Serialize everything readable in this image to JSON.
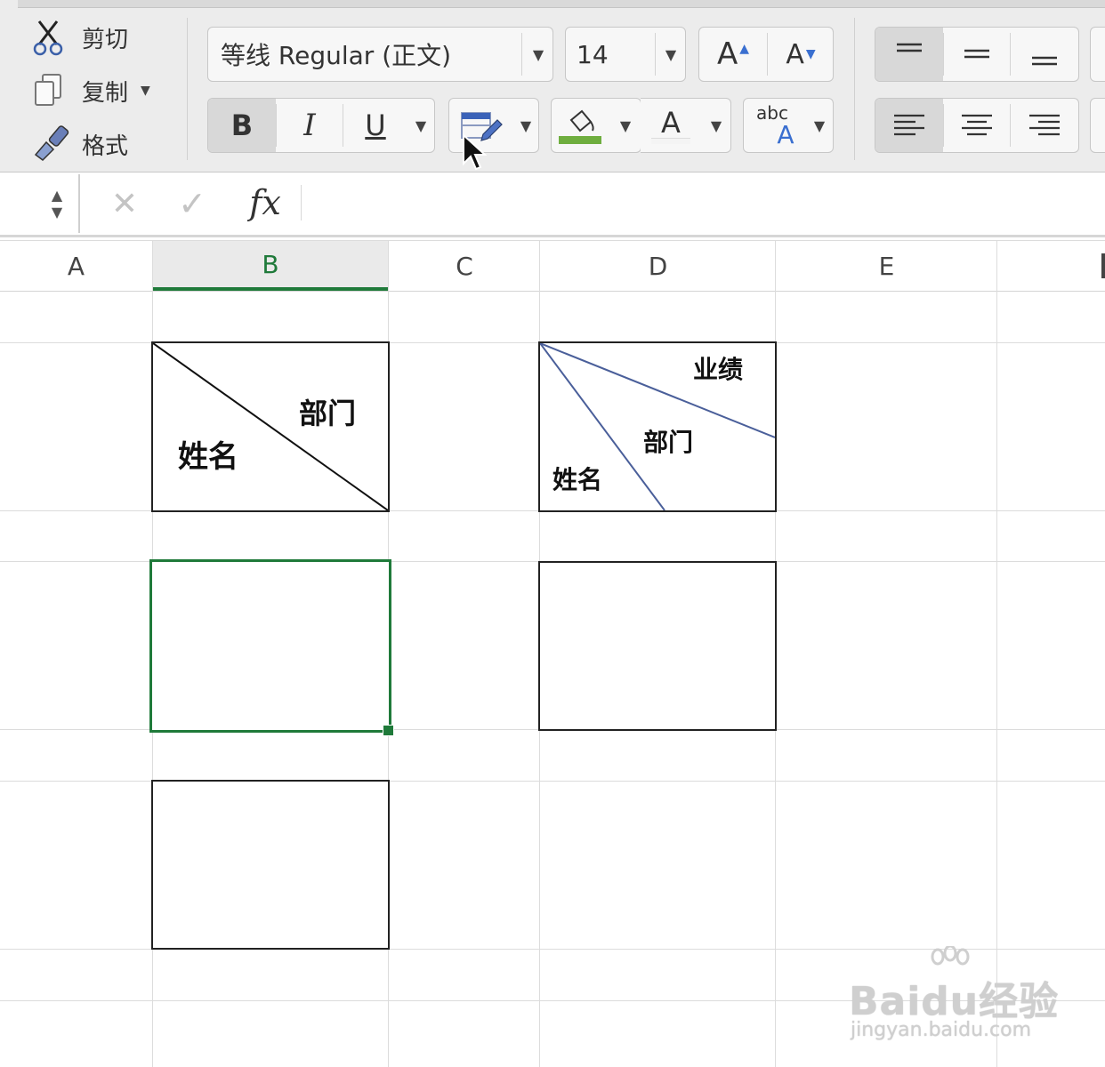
{
  "clipboard": {
    "cut_label": "剪切",
    "copy_label": "复制",
    "format_label": "格式"
  },
  "font": {
    "name_value": "等线 Regular (正文)",
    "size_value": "14",
    "grow_label": "A",
    "shrink_label": "A"
  },
  "format": {
    "bold_label": "B",
    "italic_label": "I",
    "underline_label": "U",
    "font_color_letter": "A",
    "phonetic_top": "abc",
    "phonetic_bottom": "A"
  },
  "formula_bar": {
    "fx_label": "fx",
    "cancel_glyph": "✕",
    "confirm_glyph": "✓"
  },
  "columns": [
    "A",
    "B",
    "C",
    "D",
    "E"
  ],
  "active_column": "B",
  "cells": {
    "b_header": {
      "top_right": "部门",
      "bottom_left": "姓名"
    },
    "d_header": {
      "top_right": "业绩",
      "middle": "部门",
      "bottom_left": "姓名"
    }
  },
  "colors": {
    "accent_green": "#1f7a3a",
    "fill_color_bar": "#6fae3f",
    "diag_line_blue": "#4a5f9a"
  },
  "watermark": {
    "brand": "Baidu经验",
    "url": "jingyan.baidu.com"
  }
}
